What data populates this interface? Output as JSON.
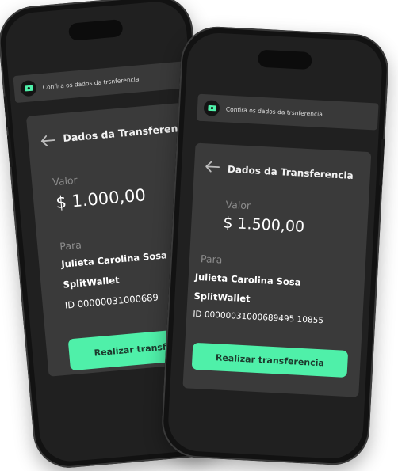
{
  "phone_back": {
    "notification": {
      "icon": "money-icon",
      "text": "Confira os dados da trsnferencia"
    },
    "card": {
      "title": "Dados da Transferencia",
      "value_label": "Valor",
      "amount": "$ 1.000,00",
      "to_label": "Para",
      "recipient_name": "Julieta Carolina Sosa",
      "wallet": "SplitWallet",
      "id_text": "ID 00000031000689",
      "button_label": "Realizar transferencia"
    }
  },
  "phone_front": {
    "notification": {
      "icon": "money-icon",
      "text": "Confira os dados da trsnferencia"
    },
    "card": {
      "title": "Dados da Transferencia",
      "value_label": "Valor",
      "amount": "$ 1.500,00",
      "to_label": "Para",
      "recipient_name": "Julieta Carolina Sosa",
      "wallet": "SplitWallet",
      "id_text": "ID 00000031000689495 10855",
      "button_label": "Realizar transferencia"
    }
  },
  "colors": {
    "accent": "#4ff0a9",
    "card": "#3a3a3a",
    "screen": "#202020"
  }
}
